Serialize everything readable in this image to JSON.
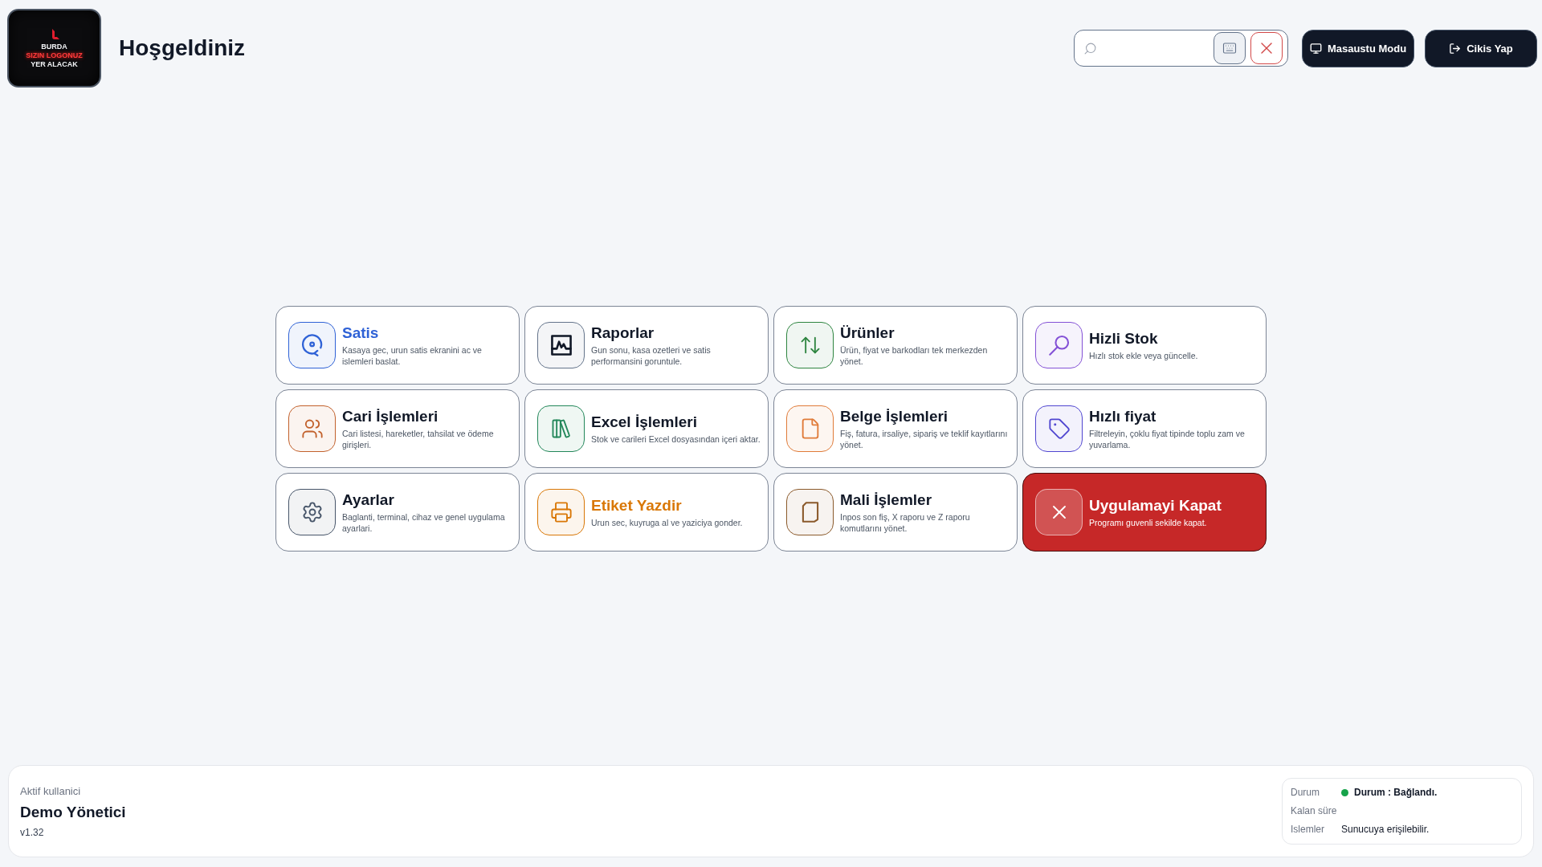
{
  "header": {
    "logo": {
      "top": "BURDA",
      "highlight": "SIZIN LOGONUZ",
      "bottom": "YER ALACAK"
    },
    "title": "Hoşgeldiniz",
    "buttons": [
      {
        "label": "Masaustu Modu"
      },
      {
        "label": "Cikis Yap"
      }
    ]
  },
  "cards": [
    {
      "kind": "normal",
      "title": "Satis",
      "description": "Kasaya gec, urun satis ekranini ac ve islemleri baslat.",
      "color": "#2f62d6",
      "emphasized": true
    },
    {
      "kind": "normal",
      "title": "Raporlar",
      "description": "Gun sonu, kasa ozetleri ve satis performansini goruntule.",
      "color": "#64748b",
      "emphasized": false
    },
    {
      "kind": "normal",
      "title": "Ürünler",
      "description": "Ürün, fiyat ve barkodları tek merkezden yönet.",
      "color": "#2e8540",
      "emphasized": false
    },
    {
      "kind": "normal",
      "title": "Hizli Stok",
      "description": "Hızlı stok ekle veya güncelle.",
      "color": "#8451d6",
      "emphasized": false
    },
    {
      "kind": "normal",
      "title": "Cari İşlemleri",
      "description": "Cari listesi, hareketler, tahsilat ve ödeme girişleri.",
      "color": "#c2612c",
      "emphasized": false
    },
    {
      "kind": "normal",
      "title": "Excel İşlemleri",
      "description": "Stok ve carileri Excel dosyasından içeri aktar.",
      "color": "#23875a",
      "emphasized": false
    },
    {
      "kind": "normal",
      "title": "Belge İşlemleri",
      "description": "Fiş, fatura, irsaliye, sipariş ve teklif kayıtlarını yönet.",
      "color": "#e07b39",
      "emphasized": false
    },
    {
      "kind": "normal",
      "title": "Hızlı fiyat",
      "description": "Filtreleyin, çoklu fiyat tipinde toplu zam ve yuvarlama.",
      "color": "#5046d0",
      "emphasized": false
    },
    {
      "kind": "normal",
      "title": "Ayarlar",
      "description": "Baglanti, terminal, cihaz ve genel uygulama ayarlari.",
      "color": "#475569",
      "emphasized": false
    },
    {
      "kind": "normal",
      "title": "Etiket Yazdir",
      "description": "Urun sec, kuyruga al ve yaziciya gonder.",
      "color": "#d97706",
      "emphasized": true
    },
    {
      "kind": "normal",
      "title": "Mali İşlemler",
      "description": "Inpos son fiş, X raporu ve Z raporu komutlarını yönet.",
      "color": "#8b5a2b",
      "emphasized": false
    },
    {
      "kind": "danger",
      "title": "Uygulamayi Kapat",
      "description": "Programı guvenli sekilde kapat.",
      "color": "#c62828",
      "emphasized": false
    }
  ],
  "footer": {
    "user_label": "Aktif kullanici",
    "user_name": "Demo Yönetici",
    "version": "v1.32",
    "status": [
      {
        "kind": "status",
        "label": "Durum",
        "value": "Durum : Bağlandı.",
        "color": "#16a34a"
      },
      {
        "kind": "text",
        "label": "Kalan süre"
      },
      {
        "kind": "text",
        "label": "Islemler",
        "value": "Sunucuya erişilebilir."
      }
    ]
  }
}
